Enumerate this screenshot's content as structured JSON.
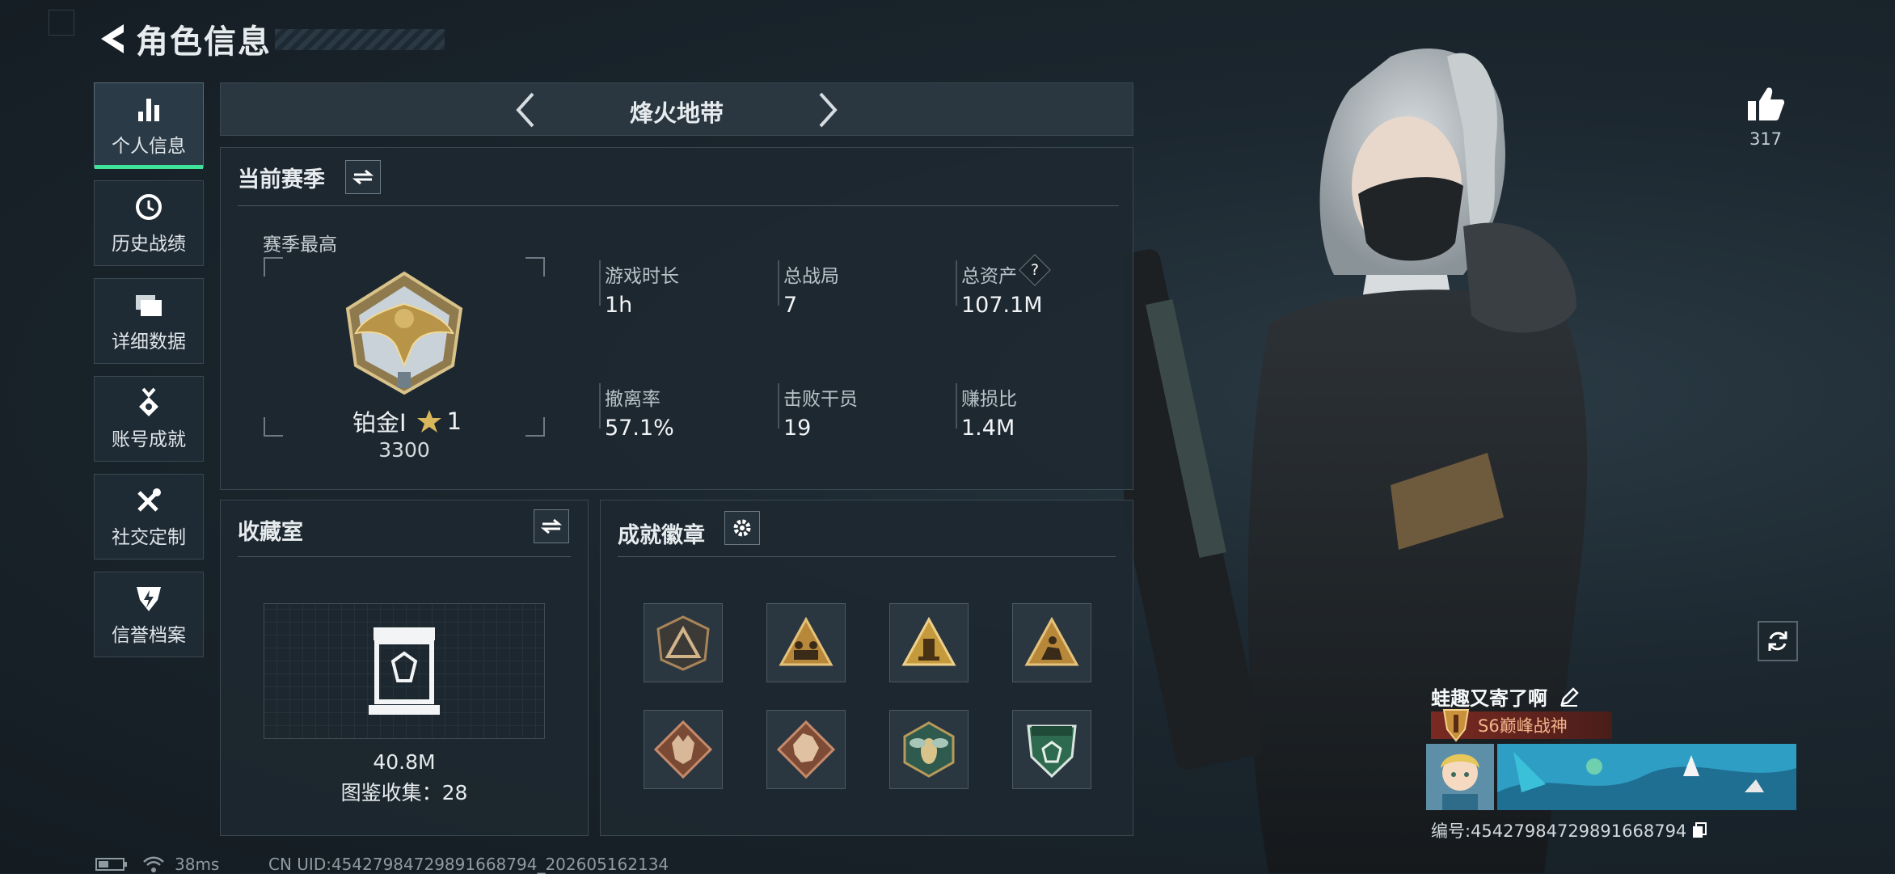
{
  "header": {
    "title": "角色信息"
  },
  "sidebar": {
    "items": [
      {
        "label": "个人信息",
        "icon": "bar-chart-icon",
        "active": true
      },
      {
        "label": "历史战绩",
        "icon": "history-clock-icon"
      },
      {
        "label": "详细数据",
        "icon": "folders-icon"
      },
      {
        "label": "账号成就",
        "icon": "medal-icon"
      },
      {
        "label": "社交定制",
        "icon": "tools-icon"
      },
      {
        "label": "信誉档案",
        "icon": "shield-lightning-icon"
      }
    ]
  },
  "mode": {
    "name": "烽火地带"
  },
  "season": {
    "title": "当前赛季",
    "best_label": "赛季最高",
    "rank_name": "铂金Ⅰ",
    "rank_stars": "1",
    "rank_points": "3300",
    "stats": [
      {
        "label": "游戏时长",
        "value": "1h"
      },
      {
        "label": "总战局",
        "value": "7"
      },
      {
        "label": "总资产",
        "value": "107.1M",
        "help": "?"
      },
      {
        "label": "撤离率",
        "value": "57.1%"
      },
      {
        "label": "击败干员",
        "value": "19"
      },
      {
        "label": "赚损比",
        "value": "1.4M"
      }
    ]
  },
  "collection": {
    "title": "收藏室",
    "value": "40.8M",
    "count_text": "图鉴收集：28"
  },
  "achievements": {
    "title": "成就徽章",
    "badges": [
      "bronze-triangle-badge",
      "team-triangle-badge",
      "supply-triangle-badge",
      "crouch-triangle-badge",
      "wolf-diamond-badge",
      "beast-diamond-badge",
      "wasp-hex-badge",
      "green-shield-badge"
    ]
  },
  "profile": {
    "likes": "317",
    "player_name": "蛙趣又寄了啊",
    "title": "S6巅峰战神",
    "uid_text": "编号:4542798472989166879​4"
  },
  "status": {
    "ping": "38ms",
    "cn_uid": "CN UID:45427984729891668794_202605162134"
  }
}
